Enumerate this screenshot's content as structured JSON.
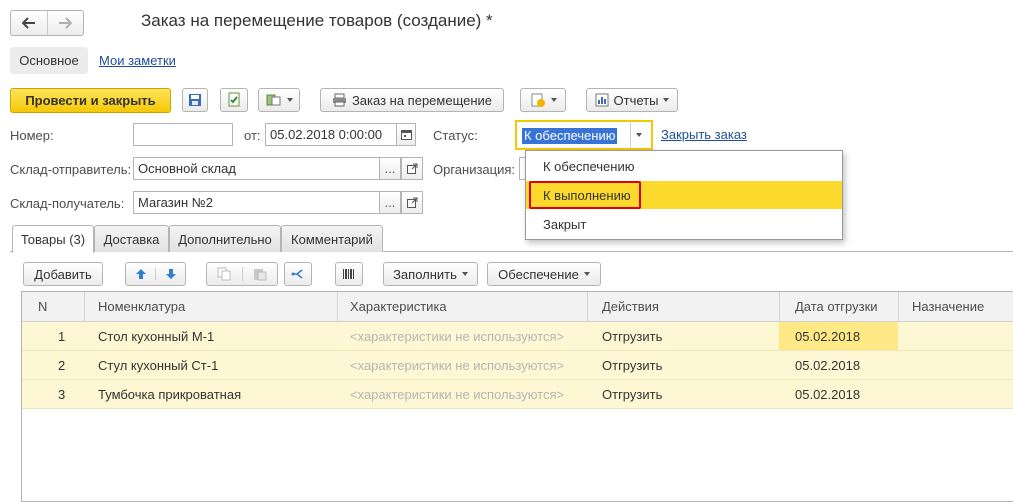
{
  "window": {
    "title": "Заказ на перемещение товаров (создание) *"
  },
  "nav": {
    "back_icon": "arrow-left-icon",
    "forward_icon": "arrow-right-icon"
  },
  "subtabs": {
    "main": "Основное",
    "notes": "Мои заметки"
  },
  "toolbar": {
    "post_close": "Провести и закрыть",
    "move_order": "Заказ на перемещение",
    "reports": "Отчеты"
  },
  "form": {
    "number_label": "Номер:",
    "number_value": "",
    "date_label": "от:",
    "date_value": "05.02.2018  0:00:00",
    "status_label": "Статус:",
    "status_value": "К обеспечению",
    "close_order": "Закрыть заказ",
    "sender_label": "Склад-отправитель:",
    "sender_value": "Основной склад",
    "org_label": "Организация:",
    "receiver_label": "Склад-получатель:",
    "receiver_value": "Магазин №2",
    "ellipsis": "..."
  },
  "status_dropdown": {
    "options": [
      "К обеспечению",
      "К выполнению",
      "Закрыт"
    ],
    "highlighted_index": 1
  },
  "tabs": [
    "Товары (3)",
    "Доставка",
    "Дополнительно",
    "Комментарий"
  ],
  "table_toolbar": {
    "add": "Добавить",
    "fill": "Заполнить",
    "provision": "Обеспечение"
  },
  "table": {
    "columns": [
      "N",
      "Номенклатура",
      "Характеристика",
      "Действия",
      "Дата отгрузки",
      "Назначение"
    ],
    "rows": [
      {
        "n": "1",
        "item": "Стол кухонный М-1",
        "char": "<характеристики не используются>",
        "action": "Отгрузить",
        "date": "05.02.2018",
        "purpose": ""
      },
      {
        "n": "2",
        "item": "Стул кухонный Ст-1",
        "char": "<характеристики не используются>",
        "action": "Отгрузить",
        "date": "05.02.2018",
        "purpose": ""
      },
      {
        "n": "3",
        "item": "Тумбочка прикроватная",
        "char": "<характеристики не используются>",
        "action": "Отгрузить",
        "date": "05.02.2018",
        "purpose": ""
      }
    ]
  },
  "colors": {
    "accent": "#f5c805",
    "selection": "#ffe054",
    "highlight_border": "#e00000",
    "row_bg": "#fdf7d4"
  }
}
